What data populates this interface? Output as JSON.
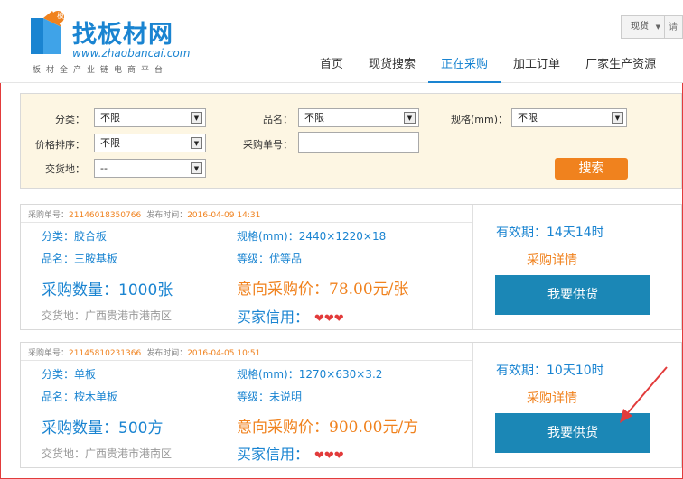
{
  "brand": {
    "badge": "板",
    "name": "找板材网",
    "url": "www.zhaobancai.com",
    "tagline": "板材全产业链电商平台",
    "color": "#1a84d1"
  },
  "search": {
    "select_value": "现货",
    "placeholder": "请"
  },
  "nav": [
    {
      "label": "首页"
    },
    {
      "label": "现货搜索"
    },
    {
      "label": "正在采购"
    },
    {
      "label": "加工订单"
    },
    {
      "label": "厂家生产资源"
    }
  ],
  "filter": {
    "category_label": "分类：",
    "category_value": "不限",
    "name_label": "品名：",
    "name_value": "不限",
    "spec_label": "规格(mm)：",
    "spec_value": "不限",
    "price_sort_label": "价格排序：",
    "price_sort_value": "不限",
    "order_no_label": "采购单号：",
    "order_no_value": "",
    "delivery_label": "交货地：",
    "delivery_value": "--",
    "search_button": "搜索"
  },
  "cards": [
    {
      "order_label": "采购单号：",
      "order_no": "21146018350766",
      "time_label": "发布时间：",
      "time": "2016-04-09 14:31",
      "category_label": "分类：",
      "category": "胶合板",
      "spec_label": "规格(mm)：",
      "spec": "2440×1220×18",
      "name_label": "品名：",
      "name": "三胺基板",
      "grade_label": "等级：",
      "grade": "优等品",
      "qty_label": "采购数量：",
      "qty": "1000张",
      "price_label": "意向采购价：",
      "price": "78.00元/张",
      "delivery_label": "交货地：",
      "delivery": "广西贵港市港南区",
      "credit_label": "买家信用：",
      "hearts": "❤❤❤",
      "validity_label": "有效期：",
      "validity": "14天14时",
      "detail_link": "采购详情",
      "supply_button": "我要供货"
    },
    {
      "order_label": "采购单号：",
      "order_no": "21145810231366",
      "time_label": "发布时间：",
      "time": "2016-04-05 10:51",
      "category_label": "分类：",
      "category": "单板",
      "spec_label": "规格(mm)：",
      "spec": "1270×630×3.2",
      "name_label": "品名：",
      "name": "桉木单板",
      "grade_label": "等级：",
      "grade": "未说明",
      "qty_label": "采购数量：",
      "qty": "500方",
      "price_label": "意向采购价：",
      "price": "900.00元/方",
      "delivery_label": "交货地：",
      "delivery": "广西贵港市港南区",
      "credit_label": "买家信用：",
      "hearts": "❤❤❤",
      "validity_label": "有效期：",
      "validity": "10天10时",
      "detail_link": "采购详情",
      "supply_button": "我要供货"
    }
  ],
  "colors": {
    "accent_blue": "#1a84d1",
    "accent_orange": "#f0821e",
    "button_blue": "#1b87b6",
    "annotation_red": "#e23b3b"
  }
}
